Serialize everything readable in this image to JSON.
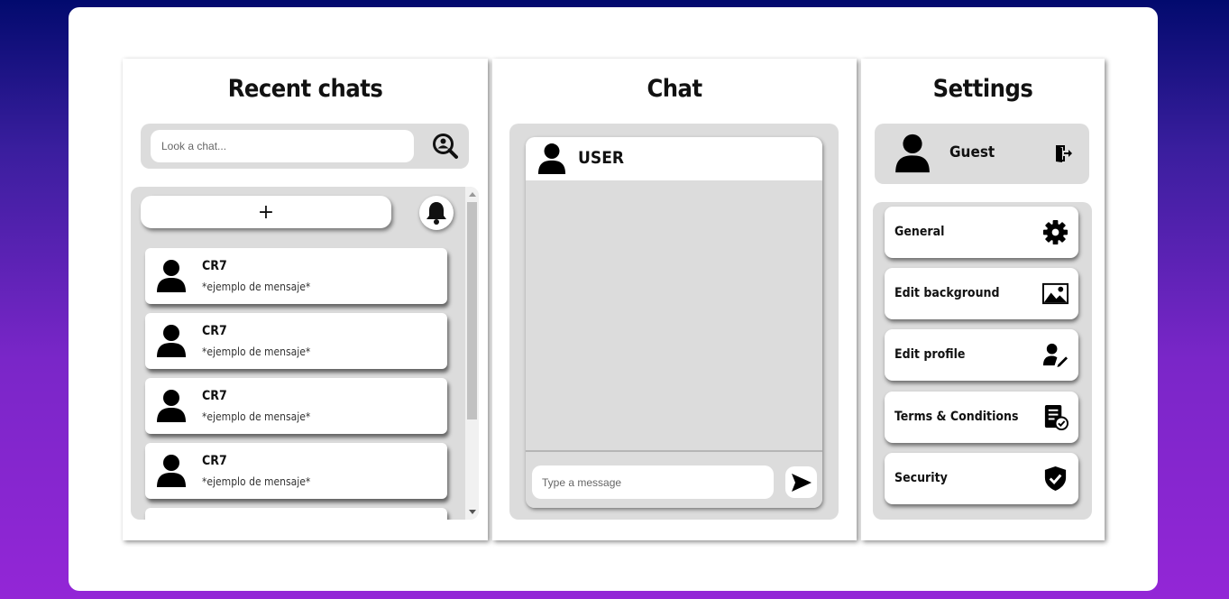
{
  "recent": {
    "title": "Recent chats",
    "search_placeholder": "Look a chat...",
    "add_label": "+",
    "chats": [
      {
        "name": "CR7",
        "message": "*ejemplo de mensaje*"
      },
      {
        "name": "CR7",
        "message": "*ejemplo de mensaje*"
      },
      {
        "name": "CR7",
        "message": "*ejemplo de mensaje*"
      },
      {
        "name": "CR7",
        "message": "*ejemplo de mensaje*"
      }
    ]
  },
  "chat": {
    "title": "Chat",
    "user": "USER",
    "input_placeholder": "Type a message"
  },
  "settings": {
    "title": "Settings",
    "profile_name": "Guest",
    "options": [
      {
        "label": "General",
        "icon": "gear-icon"
      },
      {
        "label": "Edit background",
        "icon": "image-icon"
      },
      {
        "label": "Edit profile",
        "icon": "user-edit-icon"
      },
      {
        "label": "Terms & Conditions",
        "icon": "document-check-icon"
      },
      {
        "label": "Security",
        "icon": "shield-check-icon"
      }
    ]
  }
}
